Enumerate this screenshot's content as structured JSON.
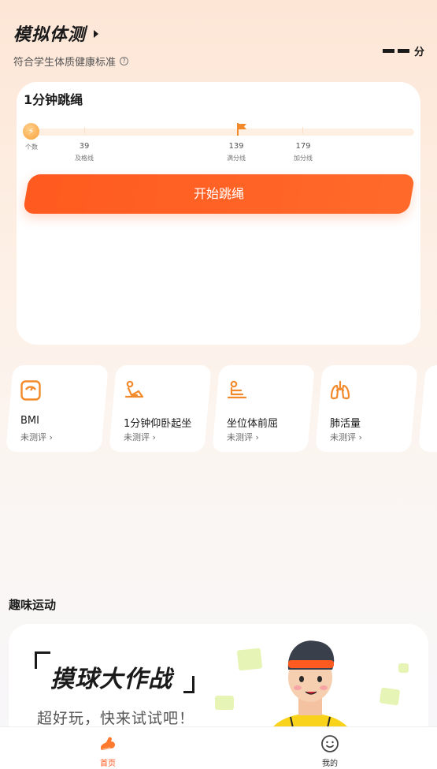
{
  "header": {
    "title": "模拟体测",
    "subtitle": "符合学生体质健康标准",
    "help": "?",
    "score_unit": "分"
  },
  "main_card": {
    "title": "1分钟跳绳",
    "runner_glyph": "⚡",
    "count_label": "个数",
    "marks": [
      {
        "value": "39",
        "label": "及格线"
      },
      {
        "value": "139",
        "label": "满分线"
      },
      {
        "value": "179",
        "label": "加分线"
      }
    ],
    "start_button": "开始跳绳"
  },
  "tests": [
    {
      "name": "BMI",
      "status": "未测评 ›",
      "icon": "scale-icon"
    },
    {
      "name": "1分钟仰卧起坐",
      "status": "未测评 ›",
      "icon": "situp-icon"
    },
    {
      "name": "坐位体前屈",
      "status": "未测评 ›",
      "icon": "sit-reach-icon"
    },
    {
      "name": "肺活量",
      "status": "未测评 ›",
      "icon": "lungs-icon"
    }
  ],
  "fun_section": {
    "title": "趣味运动",
    "banner_title": "摸球大作战",
    "banner_sub": "超好玩，快来试试吧！"
  },
  "tabbar": {
    "home": "首页",
    "mine": "我的"
  },
  "colors": {
    "accent": "#ff5a1f",
    "icon_orange": "#f28a2b"
  }
}
